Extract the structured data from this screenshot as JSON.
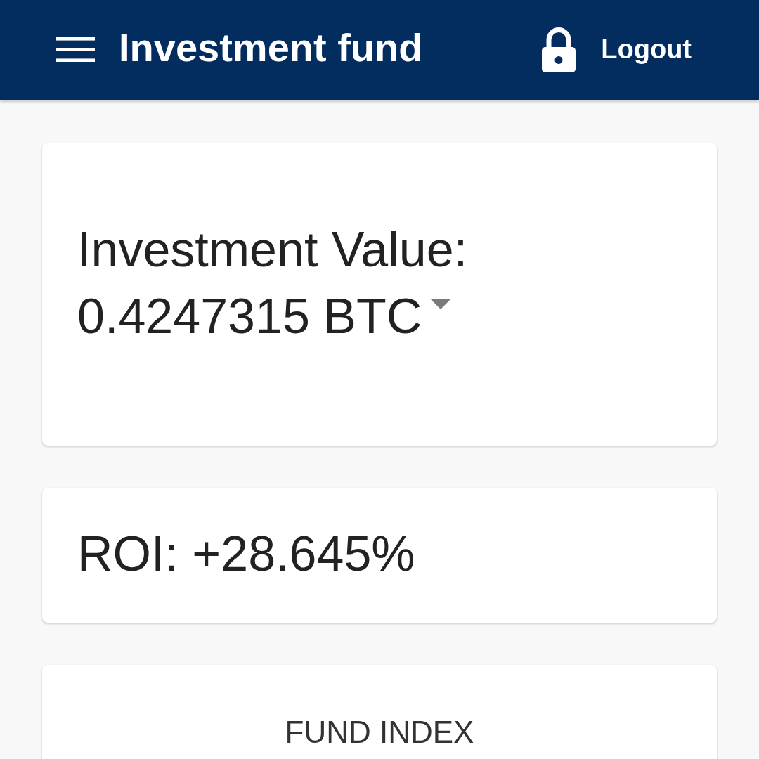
{
  "app_bar": {
    "title": "Investment fund",
    "logout_label": "Logout"
  },
  "cards": [
    {
      "kind": "value",
      "label": "Investment Value:",
      "value": "0.4247315 BTC"
    },
    {
      "kind": "text",
      "text": "ROI: +28.645%"
    },
    {
      "kind": "heading",
      "text": "FUND INDEX"
    }
  ]
}
